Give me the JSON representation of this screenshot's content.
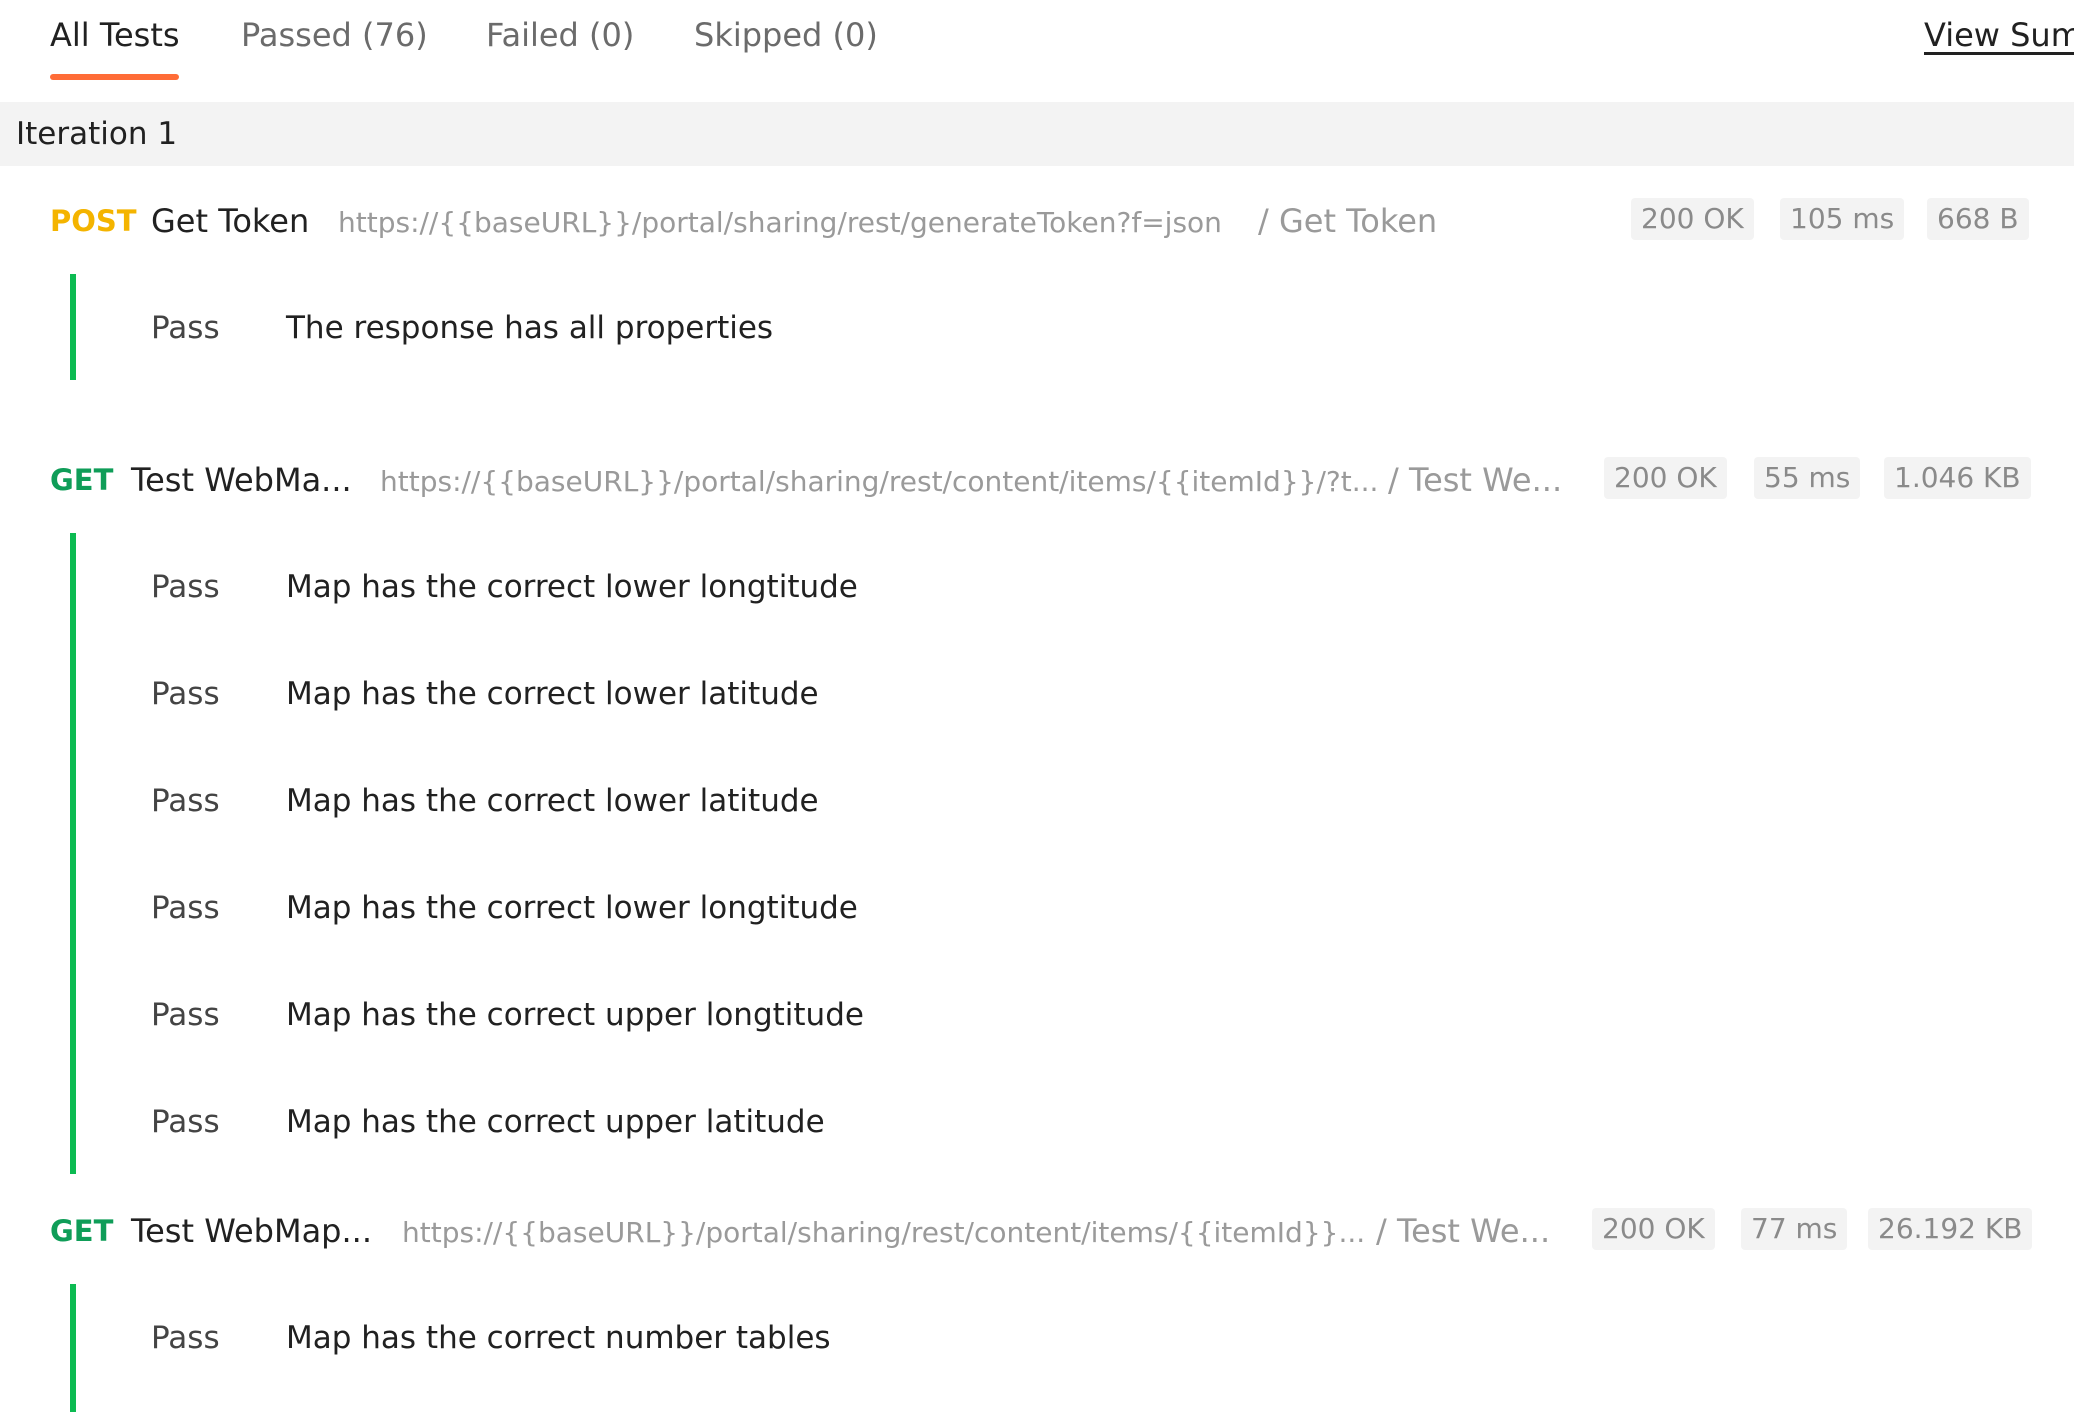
{
  "tabs": [
    {
      "label": "All Tests",
      "active": true
    },
    {
      "label": "Passed (76)",
      "active": false
    },
    {
      "label": "Failed (0)",
      "active": false
    },
    {
      "label": "Skipped (0)",
      "active": false
    }
  ],
  "view_summary_label": "View Sum",
  "accent_color": "#ff6c37",
  "iteration_label": "Iteration 1",
  "requests": [
    {
      "method": "POST",
      "method_color": "#f4b400",
      "name": "Get Token",
      "url": "https://{{baseURL}}/portal/sharing/rest/generateToken?f=json",
      "collection": "/ Get Token",
      "status": "200 OK",
      "time": "105 ms",
      "size": "668 B",
      "results": [
        {
          "status": "Pass",
          "text": "The response has all properties"
        }
      ]
    },
    {
      "method": "GET",
      "method_color": "#0f9d58",
      "name": "Test WebMa...",
      "url": "https://{{baseURL}}/portal/sharing/rest/content/items/{{itemId}}/?t...",
      "collection": "/ Test We...",
      "status": "200 OK",
      "time": "55 ms",
      "size": "1.046 KB",
      "results": [
        {
          "status": "Pass",
          "text": "Map has the correct lower longtitude"
        },
        {
          "status": "Pass",
          "text": "Map has the correct lower latitude"
        },
        {
          "status": "Pass",
          "text": "Map has the correct lower latitude"
        },
        {
          "status": "Pass",
          "text": "Map has the correct lower longtitude"
        },
        {
          "status": "Pass",
          "text": "Map has the correct upper longtitude"
        },
        {
          "status": "Pass",
          "text": "Map has the correct upper latitude"
        }
      ]
    },
    {
      "method": "GET",
      "method_color": "#0f9d58",
      "name": "Test WebMap...",
      "url": "https://{{baseURL}}/portal/sharing/rest/content/items/{{itemId}}...",
      "collection": "/ Test We...",
      "status": "200 OK",
      "time": "77 ms",
      "size": "26.192 KB",
      "results": [
        {
          "status": "Pass",
          "text": "Map has the correct number tables"
        }
      ]
    }
  ],
  "pass_bar_color": "#0cbb52"
}
